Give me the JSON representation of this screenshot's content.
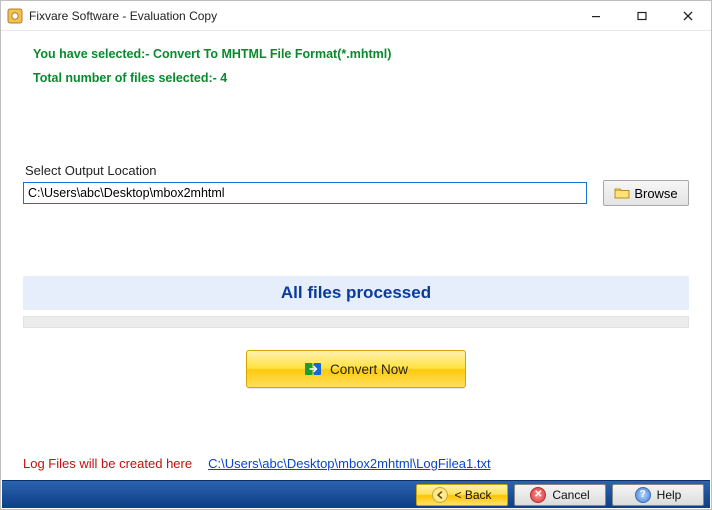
{
  "window": {
    "title": "Fixvare Software - Evaluation Copy"
  },
  "info": {
    "format_line": "You have selected:- Convert To MHTML File Format(*.mhtml)",
    "count_line": "Total number of files selected:- 4"
  },
  "output": {
    "label": "Select Output Location",
    "path": "C:\\Users\\abc\\Desktop\\mbox2mhtml",
    "browse_label": "Browse"
  },
  "status": {
    "message": "All files processed"
  },
  "convert": {
    "label": "Convert Now"
  },
  "log": {
    "label": "Log Files will be created here",
    "path": "C:\\Users\\abc\\Desktop\\mbox2mhtml\\LogFilea1.txt"
  },
  "footer": {
    "back": "< Back",
    "cancel": "Cancel",
    "help": "Help"
  }
}
